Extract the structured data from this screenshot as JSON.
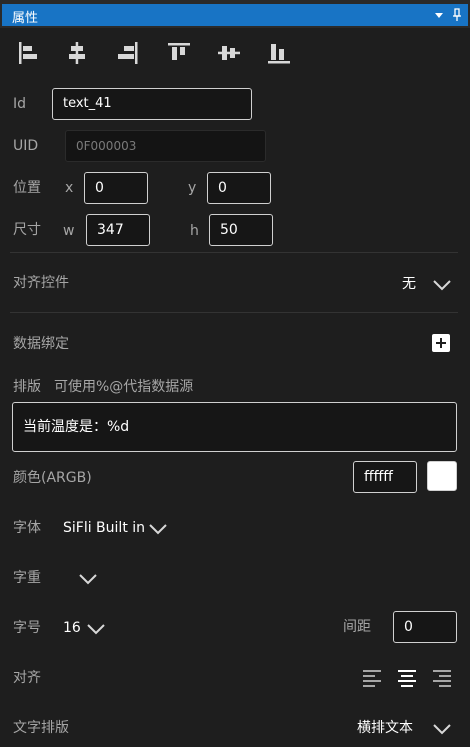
{
  "panel": {
    "title": "属性",
    "dropdown_icon": "triangle-down-icon",
    "pin_icon": "pin-icon"
  },
  "align_tools": [
    {
      "name": "align-left-tool"
    },
    {
      "name": "align-center-h-tool"
    },
    {
      "name": "align-right-tool"
    },
    {
      "name": "align-top-tool"
    },
    {
      "name": "align-center-v-tool"
    },
    {
      "name": "align-bottom-tool"
    }
  ],
  "fields": {
    "id_label": "Id",
    "id_value": "text_41",
    "uid_label": "UID",
    "uid_value": "0F000003",
    "position_label": "位置",
    "x_label": "x",
    "x_value": "0",
    "y_label": "y",
    "y_value": "0",
    "size_label": "尺寸",
    "w_label": "w",
    "w_value": "347",
    "h_label": "h",
    "h_value": "50"
  },
  "align_control": {
    "label": "对齐控件",
    "value": "无"
  },
  "data_binding": {
    "label": "数据绑定"
  },
  "layout": {
    "label": "排版",
    "hint": "可使用%@代指数据源",
    "text_value": "当前温度是：%d"
  },
  "color": {
    "label": "颜色(ARGB)",
    "value": "ffffff",
    "swatch_color": "#ffffff"
  },
  "font": {
    "label": "字体",
    "value": "SiFli Built in"
  },
  "weight": {
    "label": "字重",
    "value": ""
  },
  "font_size": {
    "label": "字号",
    "value": "16",
    "spacing_label": "间距",
    "spacing_value": "0"
  },
  "alignment": {
    "label": "对齐",
    "options": [
      "align-left-icon",
      "align-center-icon",
      "align-right-icon"
    ],
    "selected": "align-center-icon"
  },
  "text_layout": {
    "label": "文字排版",
    "value": "横排文本"
  },
  "colors": {
    "accent": "#1874c5",
    "background": "#1e1e1e",
    "field_bg": "#161616"
  }
}
